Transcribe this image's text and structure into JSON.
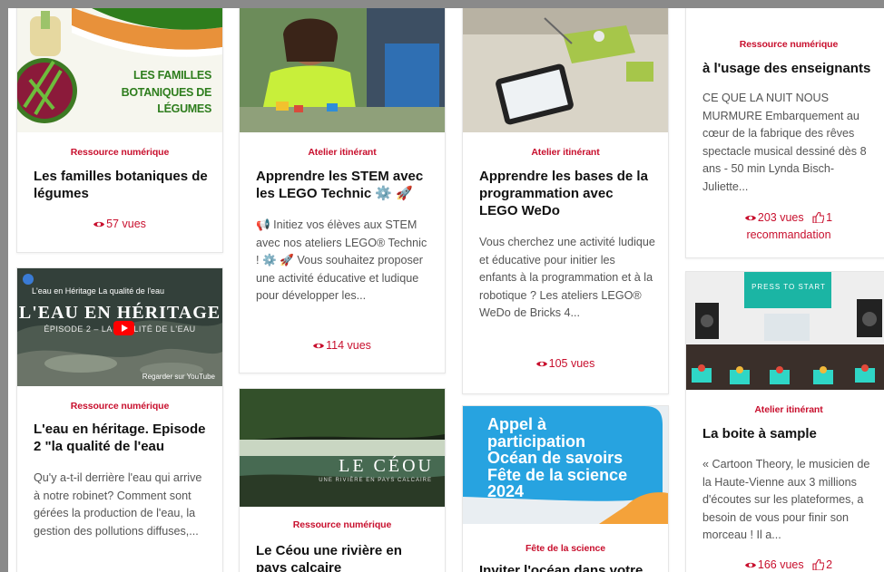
{
  "cards": [
    {
      "category": "Ressource numérique",
      "title": "Les familles botaniques de légumes",
      "thumb_text": [
        "LES FAMILLES",
        "BOTANIQUES DE",
        "LÉGUMES"
      ],
      "views": "57 vues"
    },
    {
      "category": "Ressource numérique",
      "title": "L'eau en héritage. Episode 2 \"la qualité de l'eau",
      "description": "Qu'y a-t-il derrière l'eau qui arrive à notre robinet? Comment sont gérées la production de l'eau, la gestion des pollutions diffuses,...",
      "video_title": "L'eau en Héritage La qualité de l'eau",
      "video_big": "L'EAU EN HÉRITAGE",
      "video_sub": "ÉPISODE 2 – LA QUALITÉ DE L'EAU",
      "video_footer": "Regarder sur YouTube"
    },
    {
      "category": "Atelier itinérant",
      "title": "Apprendre les STEM avec les LEGO Technic ⚙️ 🚀",
      "description": "📢 Initiez vos élèves aux STEM avec nos ateliers LEGO® Technic ! ⚙️ 🚀 Vous souhaitez proposer une activité éducative et ludique pour développer les...",
      "views": "114 vues"
    },
    {
      "category": "Ressource numérique",
      "title": "Le Céou une rivière en pays calcaire",
      "thumb_word": "LE CÉOU",
      "thumb_sub": "UNE RIVIÈRE EN PAYS CALCAIRE"
    },
    {
      "category": "Atelier itinérant",
      "title": "Apprendre les bases de la programmation avec LEGO WeDo",
      "description": "Vous cherchez une activité ludique et éducative pour initier les enfants à la programmation et à la robotique ? Les ateliers LEGO® WeDo de Bricks 4...",
      "views": "105 vues"
    },
    {
      "category": "Fête de la science",
      "title": "Inviter l'océan dans votre",
      "thumb_text": [
        "Appel à",
        "participation",
        "Océan de savoirs",
        "Fête de la science",
        "2024"
      ]
    },
    {
      "category": "Ressource numérique",
      "title": "à l'usage des enseignants",
      "description": "CE QUE LA NUIT NOUS MURMURE Embarquement au cœur de la fabrique des rêves spectacle musical dessiné dès 8 ans - 50 min Lynda Bisch- Juliette...",
      "views": "203 vues",
      "recommend_count": "1",
      "recommend_label": "recommandation"
    },
    {
      "category": "Atelier itinérant",
      "title": "La boite à sample",
      "description": "« Cartoon Theory, le musicien de la Haute-Vienne aux 3 millions d'écoutes sur les plateformes, a besoin de vous pour finir son morceau ! Il a...",
      "views": "166 vues",
      "recommend_count": "2",
      "thumb_text": "PRESS TO START"
    }
  ],
  "colors": {
    "accent": "#c8102e",
    "ocean": "#27a3e0"
  }
}
